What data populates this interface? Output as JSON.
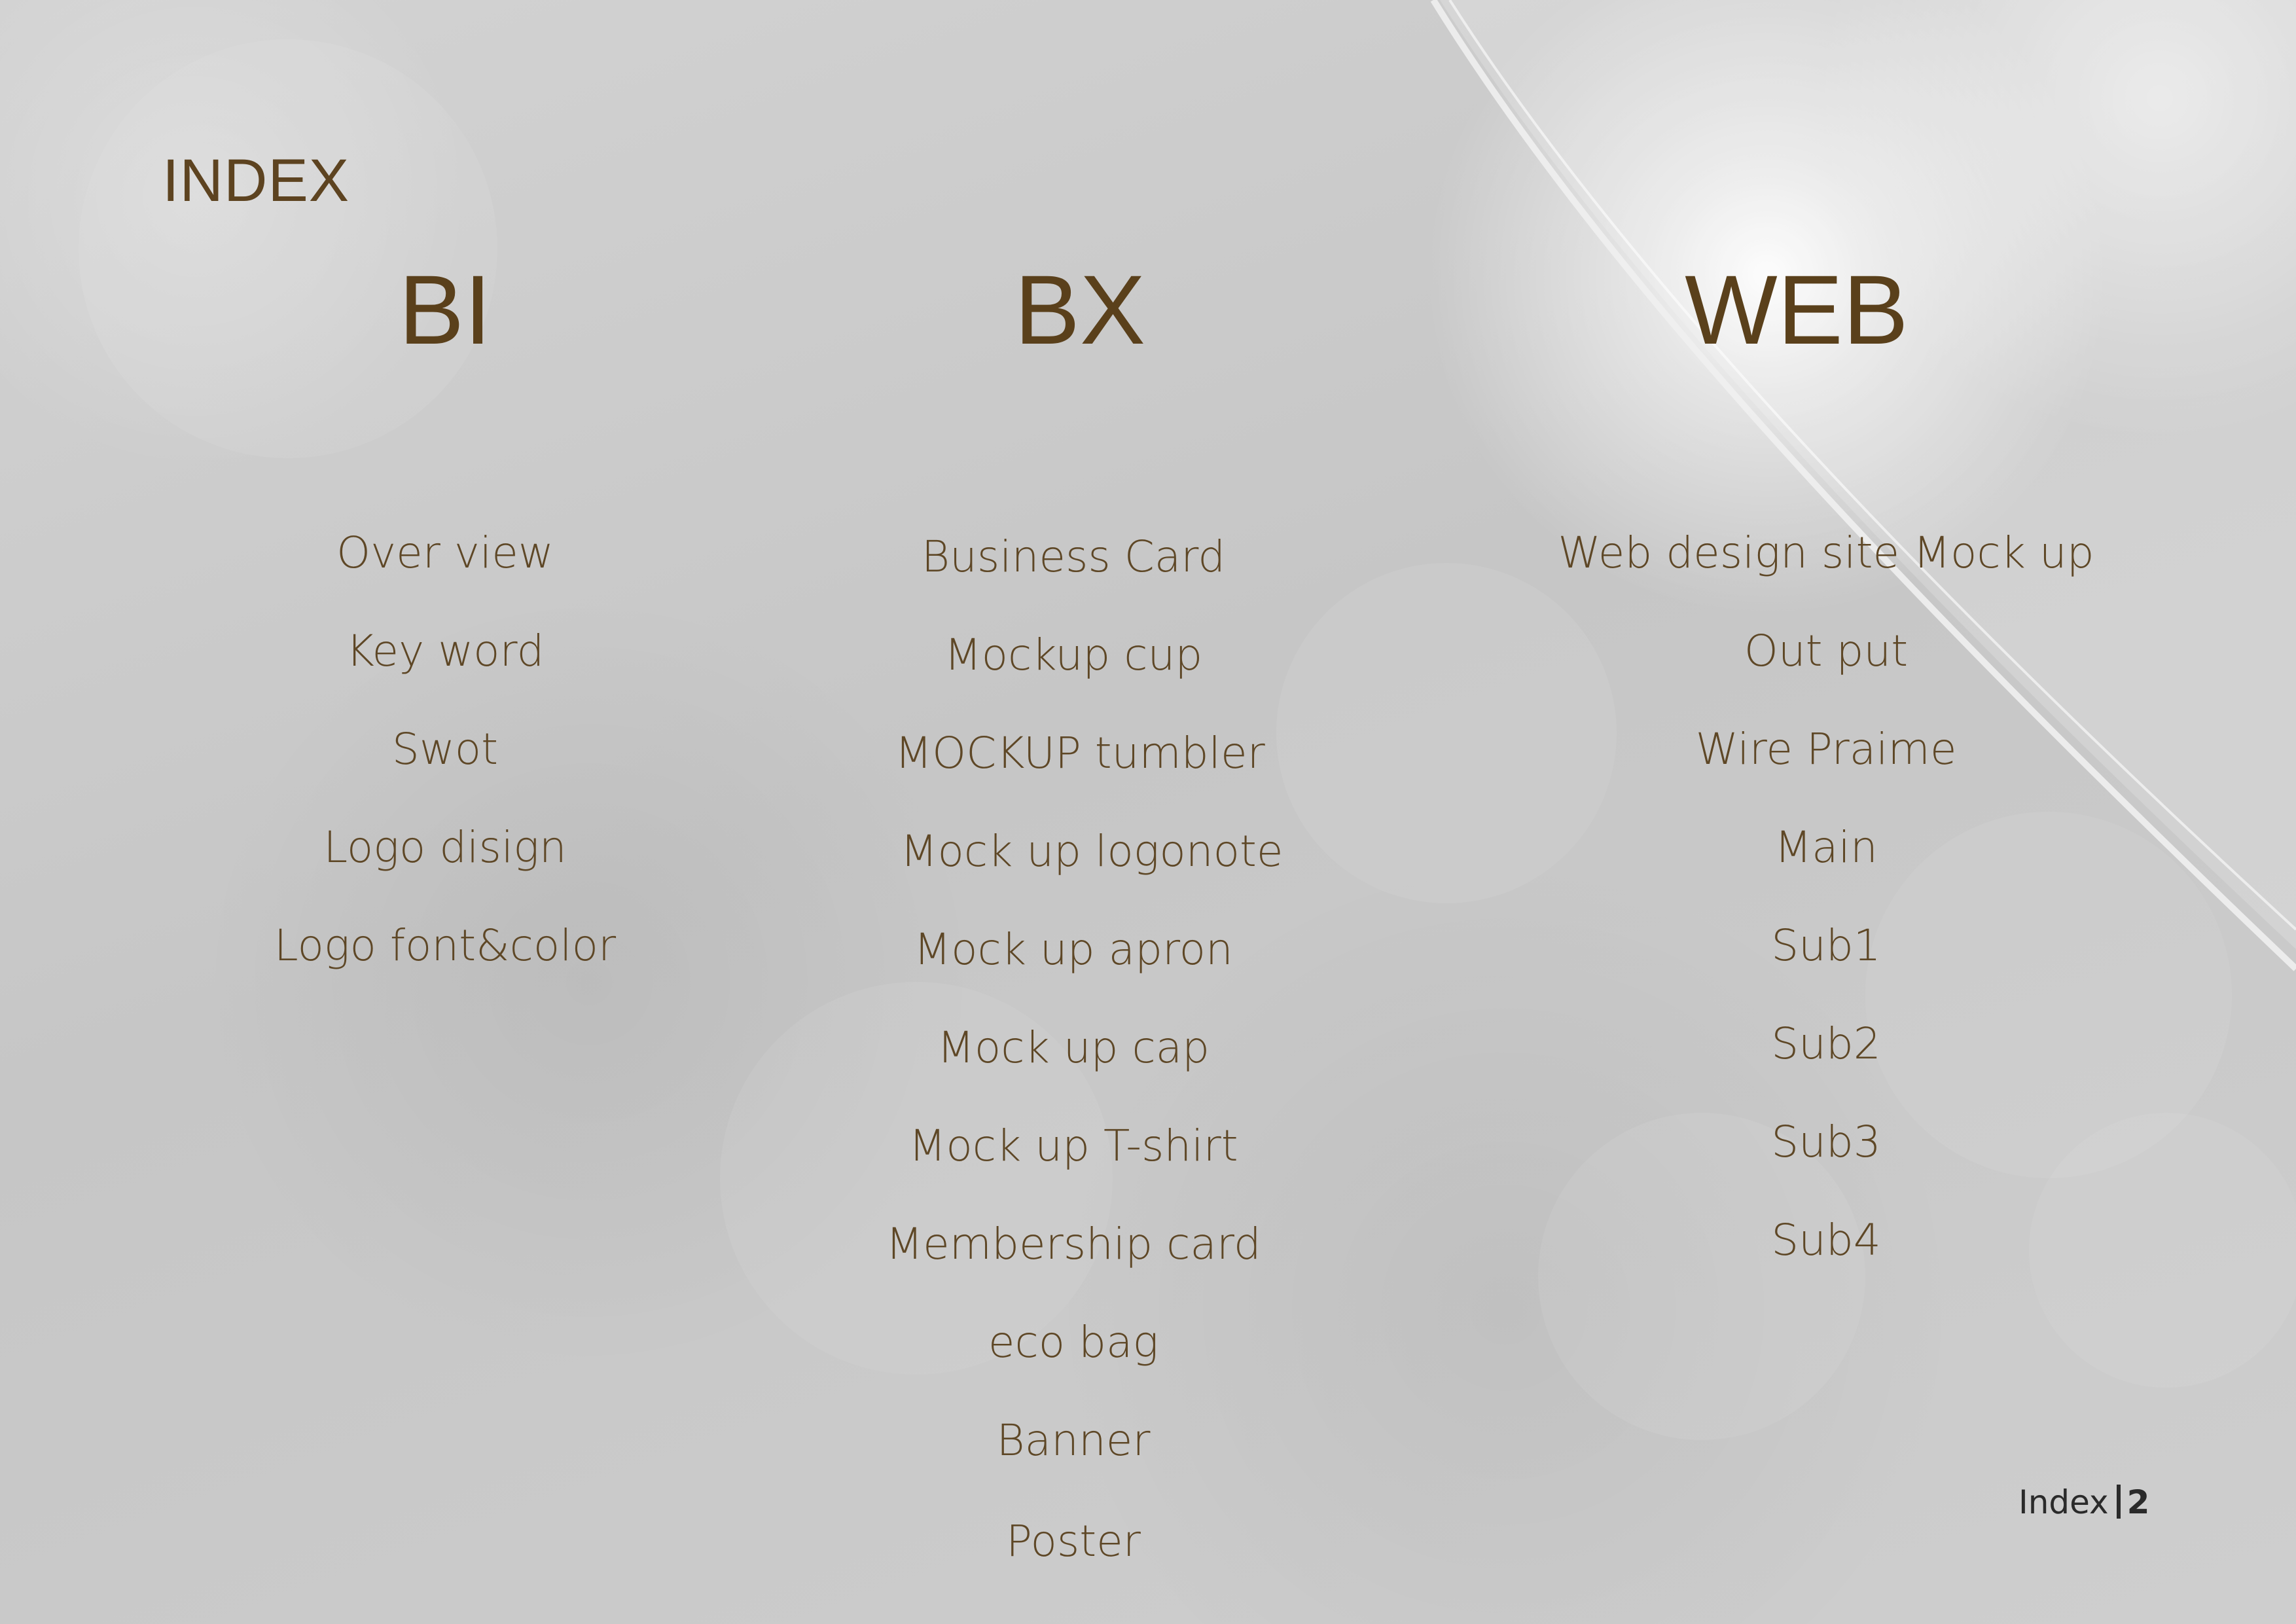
{
  "heading": "INDEX",
  "columns": [
    {
      "title": "BI",
      "items": [
        "Over view",
        "Key word",
        "Swot",
        "Logo disign",
        "Logo font&color"
      ]
    },
    {
      "title": "BX",
      "items": [
        "Business Card",
        "Mockup cup",
        "MOCKUP tumbler",
        "Mock up logonote",
        "Mock up apron",
        "Mock up cap",
        "Mock up T-shirt",
        "Membership card",
        "eco bag",
        "Banner",
        "Poster"
      ]
    },
    {
      "title": "WEB",
      "items": [
        "Web design site Mock up",
        "Out put",
        "Wire Praime",
        "Main",
        "Sub1",
        "Sub2",
        "Sub3",
        "Sub4"
      ]
    }
  ],
  "footer": {
    "label": "Index",
    "page": "2"
  },
  "colors": {
    "text": "#5e4726",
    "background": "#c9c9c9"
  }
}
